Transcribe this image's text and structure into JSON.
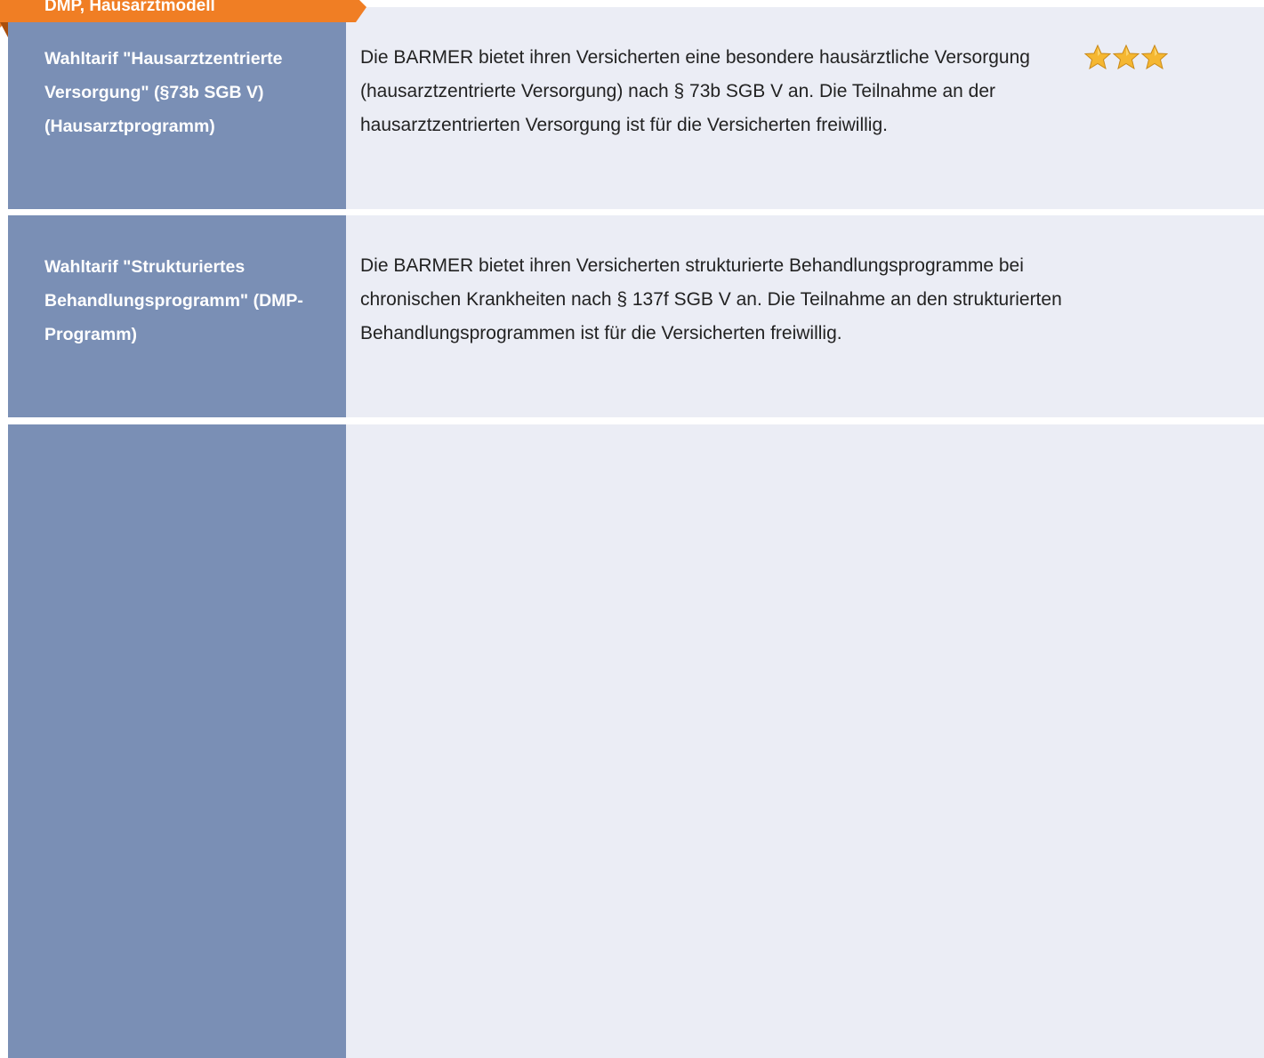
{
  "section": {
    "title": "DMP, Hausarztmodell",
    "tab_color": "#f07e24"
  },
  "rows": [
    {
      "label": "Wahltarif \"Hausarztzentrierte Versorgung\" (§73b SGB V) (Hausarztprogramm)",
      "description": "Die BARMER bietet ihren Versicherten eine besondere hausärztliche Versorgung (hausarztzentrierte Versorgung) nach § 73b SGB V an. Die Teilnahme an der hausarztzentrierten Versorgung ist für die Versicherten freiwillig.",
      "rating": {
        "stars": 3,
        "max": 3,
        "icon": "star-icon"
      }
    },
    {
      "label": "Wahltarif \"Strukturiertes Behandlungsprogramm\" (DMP-Programm)",
      "description": "Die BARMER bietet ihren Versicherten strukturierte Behandlungsprogramme bei chronischen Krankheiten nach § 137f SGB V an. Die Teilnahme an den strukturierten Behandlungsprogrammen ist für die Versicherten freiwillig."
    },
    {
      "label": "",
      "description": ""
    }
  ],
  "colors": {
    "label_bg": "#7a8fb5",
    "content_bg": "#ebedf5",
    "star": "#f5b731"
  }
}
